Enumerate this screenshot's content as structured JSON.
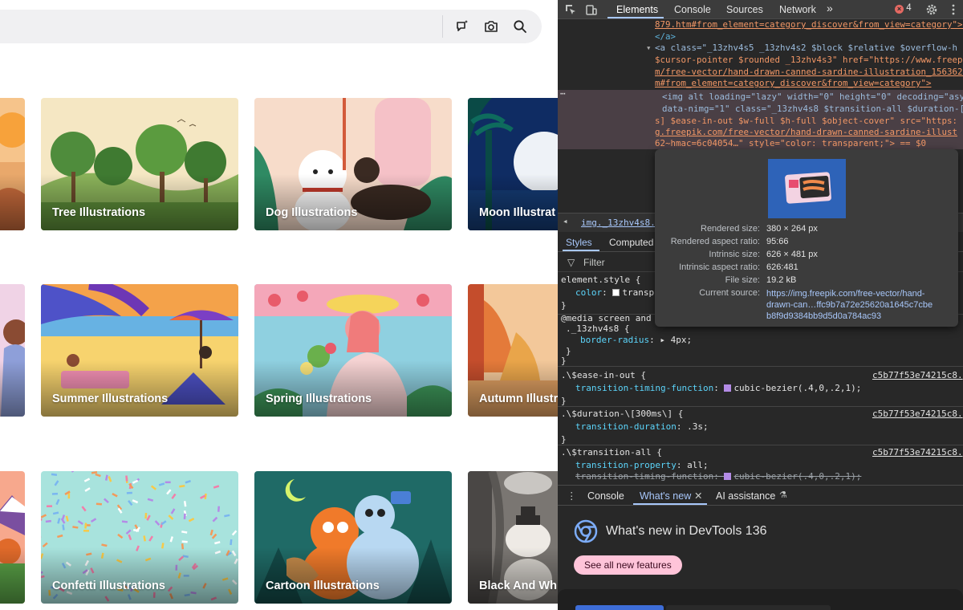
{
  "cards": [
    {
      "label": "Tree Illustrations"
    },
    {
      "label": "Dog Illustrations"
    },
    {
      "label": "Moon Illustrat"
    },
    {
      "label": "Summer Illustrations"
    },
    {
      "label": "Spring Illustrations"
    },
    {
      "label": "Autumn Illustr"
    },
    {
      "label": "Confetti Illustrations"
    },
    {
      "label": "Cartoon Illustrations"
    },
    {
      "label": "Black And Wh"
    }
  ],
  "devtools": {
    "tabs": [
      "Elements",
      "Console",
      "Sources",
      "Network"
    ],
    "error_count": "4",
    "html_lines": [
      "879.htm#from_element=category_discover&from_view=category\">(",
      "</a>",
      "<a class=\"_13zhv4s5 _13zhv4s2 $block $relative $overflow-h",
      "$cursor-pointer $rounded _13zhv4s3\" href=\"https://www.freepi",
      "m/free-vector/hand-drawn-canned-sardine-illustration_1563622",
      "m#from_element=category_discover&from_view=category\">",
      "<img alt loading=\"lazy\" width=\"0\" height=\"0\" decoding=\"asy",
      "data-nimg=\"1\" class=\"_13zhv4s8 $transition-all $duration-[3",
      "s] $ease-in-out $w-full $h-full $object-cover\" src=\"https:",
      "g.freepik.com/free-vector/hand-drawn-canned-sardine-illust",
      "62~hmac=6c04054…\" style=\"color: transparent;\"> == $0"
    ],
    "breadcrumb": "img._13zhv4s8.\\$",
    "styles_tabs": [
      "Styles",
      "Computed"
    ],
    "filter_placeholder": "Filter",
    "tooltip": {
      "rows": [
        {
          "k": "Rendered size:",
          "v": "380 × 264 px"
        },
        {
          "k": "Rendered aspect ratio:",
          "v": "95:66"
        },
        {
          "k": "Intrinsic size:",
          "v": "626 × 481 px"
        },
        {
          "k": "Intrinsic aspect ratio:",
          "v": "626:481"
        },
        {
          "k": "File size:",
          "v": "19.2 kB"
        }
      ],
      "source_key": "Current source:",
      "source_lines": [
        "https://img.freepik.com/free-vector/hand-",
        "drawn-can…ffc9b7a72e25620a1645c7cbe",
        "b8f9d9384bb9d5d0a784ac93"
      ]
    },
    "styles": {
      "element_style": "element.style {",
      "color_prop": "color",
      "color_val": "transp",
      "media": "@media screen and",
      "media_sel": "._13zhv4s8 {",
      "radius_prop": "border-radius",
      "radius_val": "4px",
      "r1_sel": ".\\$ease-in-out {",
      "r1_prop": "transition-timing-function",
      "r1_val": "cubic-bezier(.4,0,.2,1)",
      "r2_sel": ".\\$duration-\\[300ms\\] {",
      "r2_prop": "transition-duration",
      "r2_val": ".3s",
      "r3_sel": ".\\$transition-all {",
      "r3_p1": "transition-property",
      "r3_v1": "all",
      "r3_p2": "transition-timing-function",
      "r3_v2": "cubic-bezier(.4,0,.2,1)",
      "source": "c5b77f53e74215c8."
    },
    "drawer_tabs": [
      "Console",
      "What's new",
      "AI assistance"
    ],
    "whatsnew_title": "What's new in DevTools 136",
    "whatsnew_button": "See all new features"
  }
}
